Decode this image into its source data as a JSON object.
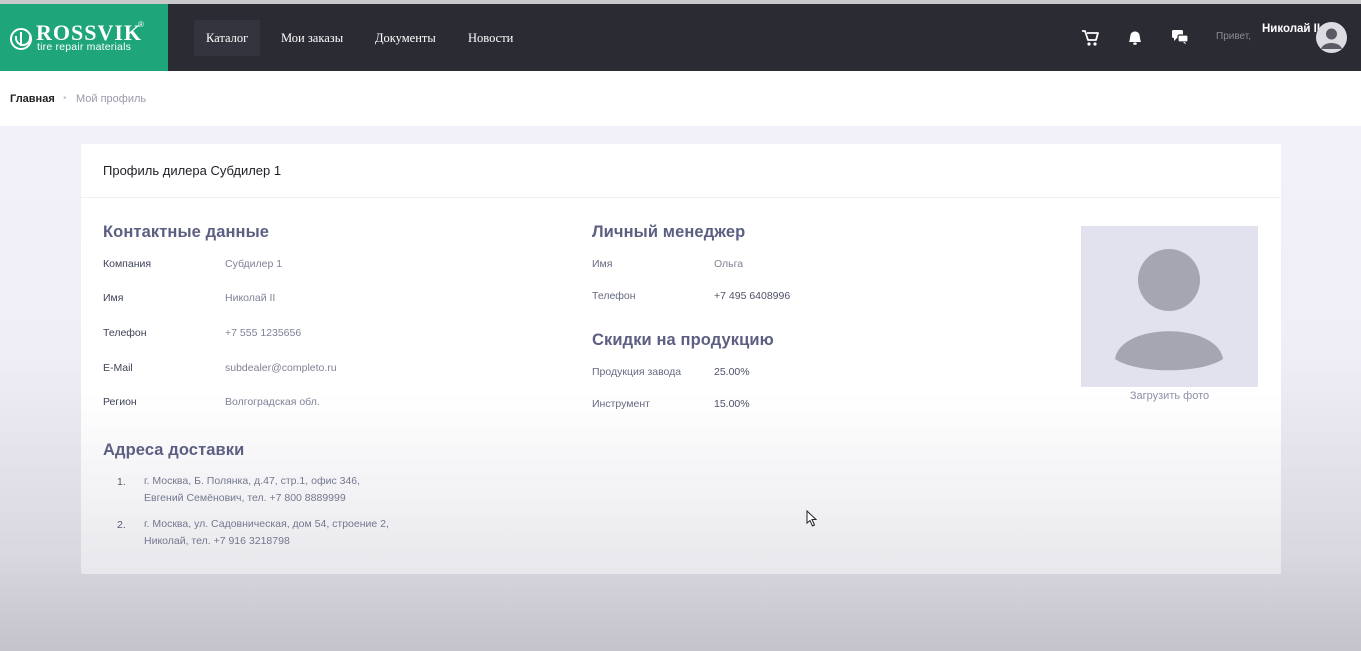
{
  "app": {
    "logo_name": "ROSSVIK",
    "logo_reg": "®",
    "logo_subtitle": "tire repair materials"
  },
  "nav": {
    "items": [
      {
        "label": "Каталог"
      },
      {
        "label": "Мои заказы"
      },
      {
        "label": "Документы"
      },
      {
        "label": "Новости"
      }
    ],
    "greeting": "Привет,",
    "user_name": "Николай II",
    "icons": [
      "cart-icon",
      "bell-icon",
      "chat-icon",
      "user-avatar-icon"
    ]
  },
  "breadcrumb": {
    "home": "Главная",
    "separator": "•",
    "current": "Мой профиль"
  },
  "profile": {
    "title": "Профиль дилера Субдилер 1",
    "contacts": {
      "title": "Контактные данные",
      "rows": [
        {
          "label": "Компания",
          "value": "Субдилер 1"
        },
        {
          "label": "Имя",
          "value": "Николай II"
        },
        {
          "label": "Телефон",
          "value": "+7 555 1235656"
        },
        {
          "label": "E-Mail",
          "value": "subdealer@completo.ru"
        },
        {
          "label": "Регион",
          "value": "Волгоградская обл."
        }
      ]
    },
    "manager": {
      "title": "Личный менеджер",
      "rows": [
        {
          "label": "Имя",
          "value": "Ольга"
        },
        {
          "label": "Телефон",
          "value": "+7 495 6408996"
        }
      ]
    },
    "discounts": {
      "title": "Скидки на продукцию",
      "rows": [
        {
          "label": "Продукция завода",
          "value": "25.00%"
        },
        {
          "label": "Инструмент",
          "value": "15.00%"
        }
      ]
    },
    "addresses": {
      "title": "Адреса доставки",
      "items": [
        {
          "num": "1.",
          "line1": "г. Москва, Б. Полянка, д.47, стр.1, офис 346,",
          "line2": "Евгений Семёнович, тел. +7 800 8889999"
        },
        {
          "num": "2.",
          "line1": "г. Москва, ул. Садовническая, дом 54, строение 2,",
          "line2": "Николай, тел. +7 916 3218798"
        }
      ]
    },
    "photo": {
      "upload_label": "Загрузить фото"
    }
  },
  "colors": {
    "brand": "#1ea57a",
    "navbar": "#2b2b33",
    "section_title": "#5c5e82",
    "notification_dot": "#2bc08b"
  }
}
